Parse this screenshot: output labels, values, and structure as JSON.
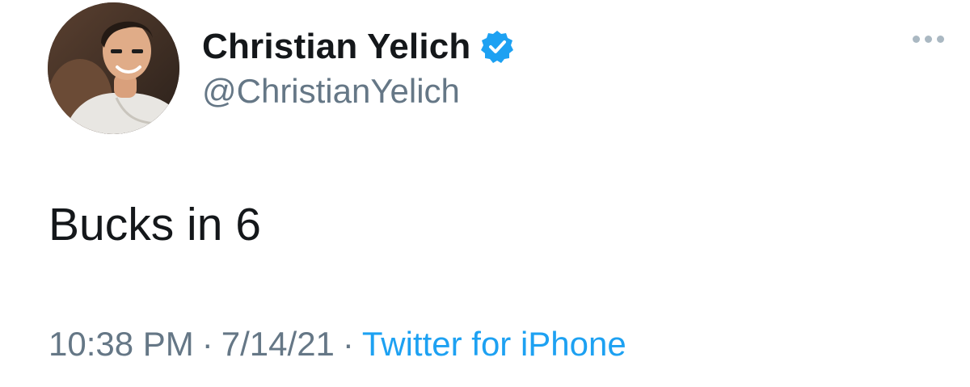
{
  "author": {
    "display_name": "Christian Yelich",
    "handle": "@ChristianYelich",
    "verified": true,
    "avatar_icon": "profile-photo"
  },
  "tweet": {
    "text": "Bucks in 6"
  },
  "meta": {
    "time": "10:38 PM",
    "separator": "·",
    "date": "7/14/21",
    "source": "Twitter for iPhone"
  },
  "actions": {
    "more_icon": "more-options-icon"
  },
  "colors": {
    "text_primary": "#14171a",
    "text_secondary": "#657786",
    "link": "#1da1f2",
    "verified_badge": "#1da1f2",
    "more_dots": "#aab8c2"
  }
}
